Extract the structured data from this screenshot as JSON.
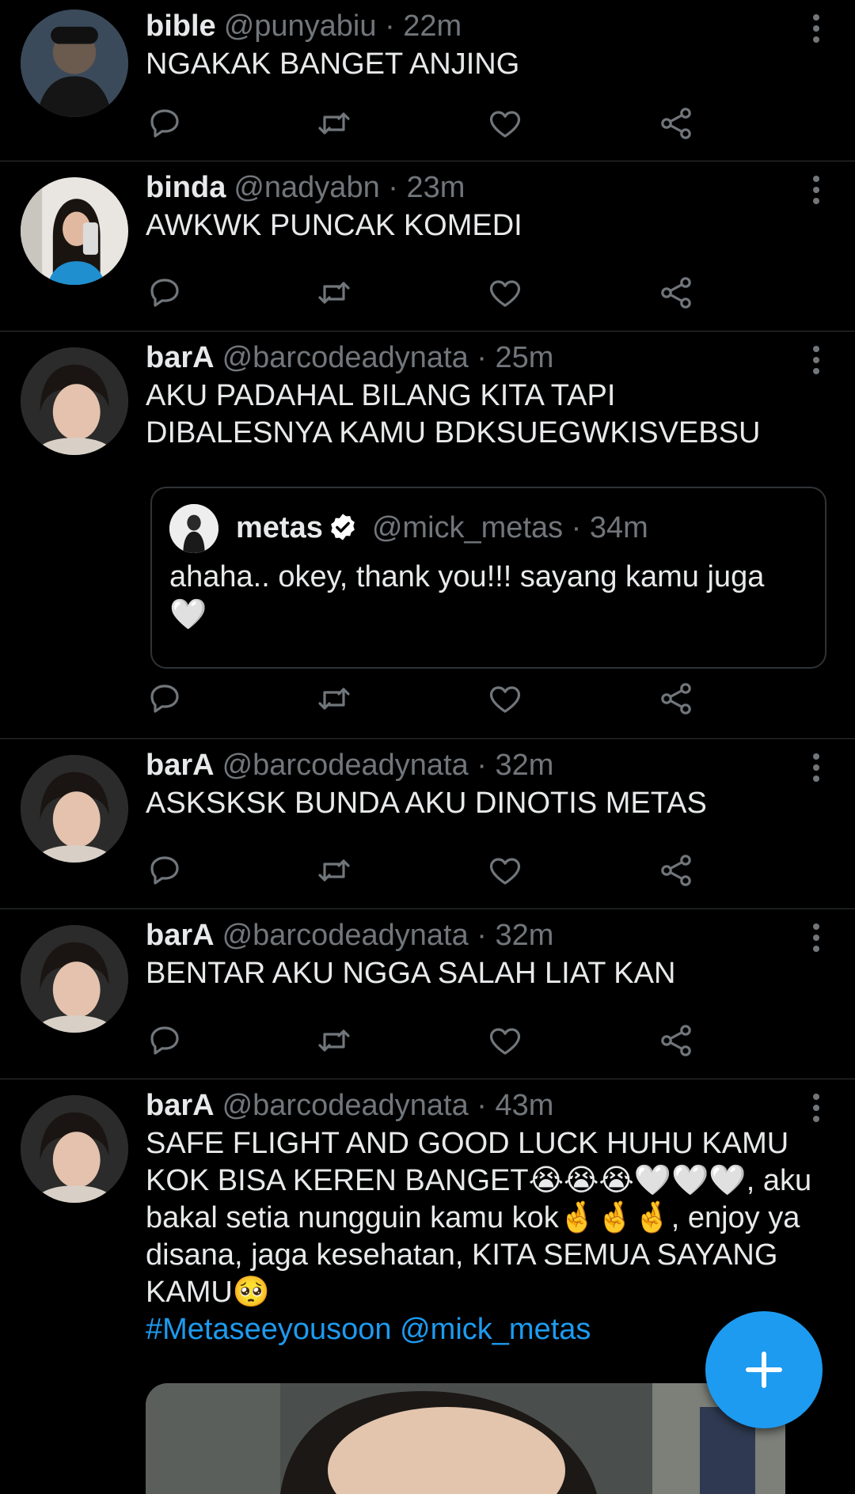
{
  "tweets": [
    {
      "name": "bible",
      "handle": "@punyabiu · 22m",
      "text": "NGAKAK BANGET ANJING"
    },
    {
      "name": "binda",
      "handle": "@nadyabn · 23m",
      "text": "AWKWK PUNCAK KOMEDI"
    },
    {
      "name": "barA",
      "handle": "@barcodeadynata · 25m",
      "text": "AKU PADAHAL BILANG KITA TAPI DIBALESNYA KAMU BDKSUEGWKISVEBSU",
      "quote": {
        "name": "metas",
        "handle": "@mick_metas · 34m",
        "text": "ahaha.. okey, thank you!!! sayang kamu juga 🤍"
      }
    },
    {
      "name": "barA",
      "handle": "@barcodeadynata · 32m",
      "text": "ASKSKSK BUNDA AKU DINOTIS METAS"
    },
    {
      "name": "barA",
      "handle": "@barcodeadynata · 32m",
      "text": "BENTAR AKU NGGA SALAH LIAT KAN"
    },
    {
      "name": "barA",
      "handle": "@barcodeadynata · 43m",
      "text": "SAFE FLIGHT AND GOOD LUCK HUHU KAMU KOK BISA KEREN BANGET😭😭😭🤍🤍🤍, aku bakal setia nungguin kamu kok🤞🤞🤞, enjoy ya disana, jaga kesehatan, KITA SEMUA SAYANG KAMU🥺",
      "tags": "#Metaseeyousoon @mick_metas"
    }
  ],
  "icons": {
    "reply": "reply-icon",
    "retweet": "retweet-icon",
    "like": "heart-icon",
    "share": "share-icon",
    "more": "more-vertical-icon",
    "compose": "plus-icon",
    "verified": "verified-badge-icon"
  },
  "colors": {
    "background": "#000000",
    "accent": "#1d9bf0",
    "text": "#e7e9ea",
    "muted": "#71767b",
    "divider": "#2f3336"
  }
}
